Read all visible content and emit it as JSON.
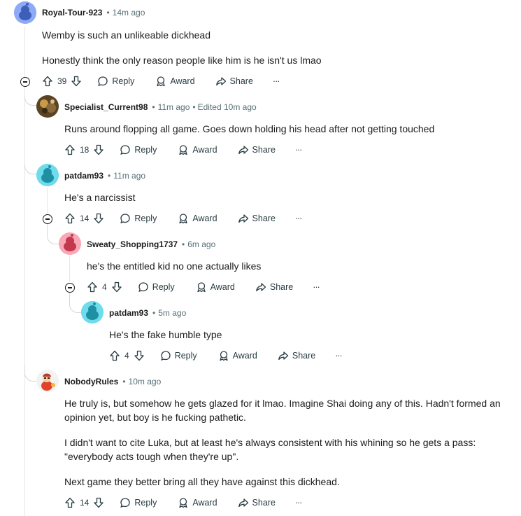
{
  "colors": {
    "meta": "#576f76",
    "text": "#1c1c1c",
    "line": "#e3e6e8"
  },
  "actions": {
    "reply": "Reply",
    "award": "Award",
    "share": "Share",
    "more": "···"
  },
  "comments": [
    {
      "username": "Royal-Tour-923",
      "time": "14m ago",
      "edited": "",
      "avatar": "snoo-blue",
      "body": [
        "Wemby is such an unlikeable dickhead",
        "Honestly think the only reason people like him is he isn't us lmao"
      ],
      "votes": "39"
    },
    {
      "username": "Specialist_Current98",
      "time": "11m ago",
      "edited": "Edited 10m ago",
      "avatar": "photo-avatar",
      "body": [
        "Runs around flopping all game. Goes down holding his head after not getting touched"
      ],
      "votes": "18"
    },
    {
      "username": "patdam93",
      "time": "11m ago",
      "edited": "",
      "avatar": "snoo-cyan",
      "body": [
        "He's a narcissist"
      ],
      "votes": "14"
    },
    {
      "username": "Sweaty_Shopping1737",
      "time": "6m ago",
      "edited": "",
      "avatar": "snoo-pink",
      "body": [
        "he's the entitled kid no one actually likes"
      ],
      "votes": "4"
    },
    {
      "username": "patdam93",
      "time": "5m ago",
      "edited": "",
      "avatar": "snoo-cyan",
      "body": [
        "He's the fake humble type"
      ],
      "votes": "4"
    },
    {
      "username": "NobodyRules",
      "time": "10m ago",
      "edited": "",
      "avatar": "snoo-costume",
      "body": [
        "He truly is, but somehow he gets glazed for it lmao. Imagine Shai doing any of this. Hadn't formed an opinion yet, but boy is he fucking pathetic.",
        "I didn't want to cite Luka, but at least he's always consistent with his whining so he gets a pass: \"everybody acts tough when they're up\".",
        "Next game they better bring all they have against this dickhead."
      ],
      "votes": "14"
    }
  ]
}
